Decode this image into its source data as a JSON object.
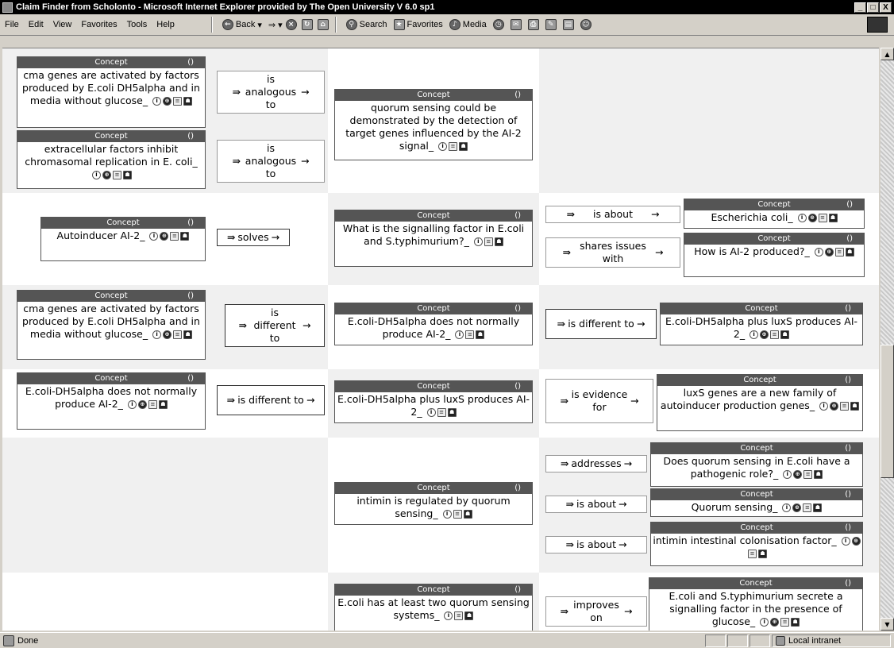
{
  "window": {
    "title": "Claim Finder from Scholonto - Microsoft Internet Explorer provided by The Open University V 6.0 sp1",
    "min": "_",
    "max": "□",
    "close": "X"
  },
  "menu": [
    "File",
    "Edit",
    "View",
    "Favorites",
    "Tools",
    "Help"
  ],
  "toolbar": {
    "back": "Back",
    "forward": "⇒",
    "search": "Search",
    "favorites": "Favorites",
    "media": "Media"
  },
  "concept_header": "Concept",
  "concept_paren": "()",
  "rows": {
    "r1": {
      "c1": "cma genes are activated by factors produced by E.coli DH5alpha and in media without glucose_",
      "l1": "is analogous to",
      "c2": "extracellular factors inhibit chromasomal replication in E. coli_",
      "l2": "is analogous to",
      "target": "quorum sensing could be demonstrated by the detection of target genes influenced by the AI-2 signal_"
    },
    "r2": {
      "src": "Autoinducer AI-2_",
      "link": "solves",
      "mid": "What is the signalling factor in E.coli and S.typhimurium?_",
      "l1": "is about",
      "t1": "Escherichia coli_",
      "l2": "shares issues with",
      "t2": "How is AI-2 produced?_"
    },
    "r3": {
      "src": "cma genes are activated by factors produced by E.coli DH5alpha and in media without glucose_",
      "link": "is different to",
      "mid": "E.coli-DH5alpha does not normally produce AI-2_",
      "l1": "is different to",
      "t1": "E.coli-DH5alpha plus luxS produces AI-2_"
    },
    "r4": {
      "src": "E.coli-DH5alpha does not normally produce AI-2_",
      "link": "is different to",
      "mid": "E.coli-DH5alpha plus luxS produces AI-2_",
      "l1": "is evidence for",
      "t1": "luxS genes are a new family of autoinducer production genes_"
    },
    "r5": {
      "mid": "intimin is regulated by quorum sensing_",
      "l1": "addresses",
      "t1": "Does quorum sensing in E.coli have a pathogenic role?_",
      "l2": "is about",
      "t2": "Quorum sensing_",
      "l3": "is about",
      "t3": "intimin intestinal colonisation factor_"
    },
    "r6": {
      "mid": "E.coli has at least two quorum sensing systems_",
      "l1": "improves on",
      "t1": "E.coli and S.typhimurium secrete a signalling factor in the presence of glucose_"
    }
  },
  "status": {
    "left": "Done",
    "zone": "Local intranet"
  }
}
